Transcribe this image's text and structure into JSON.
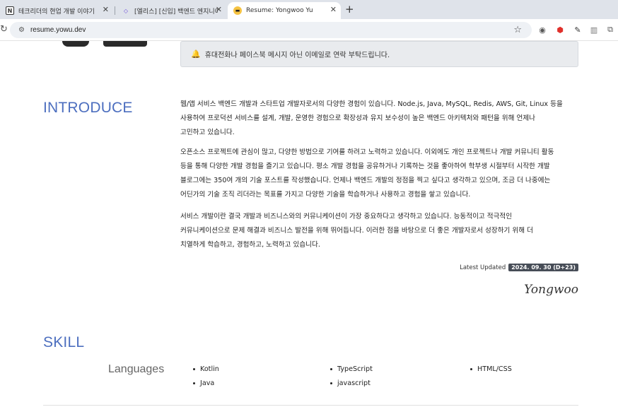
{
  "browser": {
    "tabs": [
      {
        "title": "테크리더의 현업 개발 이야기",
        "icon": "notion-icon"
      },
      {
        "title": "[엘리스] [신입] 백엔드 엔지니어 (",
        "icon": "elice-icon"
      },
      {
        "title": "Resume: Yongwoo Yu",
        "icon": "sunglasses-emoji-icon",
        "active": true
      }
    ],
    "url": "resume.yowu.dev"
  },
  "notice": {
    "text": "휴대전화나 페이스북 메시지 아닌 이메일로 연락 부탁드립니다."
  },
  "introduce": {
    "title": "INTRODUCE",
    "paragraphs": [
      [
        "웹/앱 서비스 백엔드 개발과 스타트업 개발자로서의 다양한 경험이 있습니다. Node.js, Java, MySQL, Redis, AWS, Git, Linux 등을",
        "사용하여 프로덕션 서비스를 설계, 개발, 운영한 경험으로 확장성과 유지 보수성이 높은 백엔드 아키텍처와 패턴을 위해 언제나",
        "고민하고 있습니다."
      ],
      [
        "오픈소스 프로젝트에 관심이 많고, 다양한 방법으로 기여를 하려고 노력하고 있습니다. 이외에도 개인 프로젝트나 개발 커뮤니티 활동",
        "등을 통해 다양한 개발 경험을 즐기고 있습니다. 평소 개발 경험을 공유하거나 기록하는 것을 좋아하여 학부생 시절부터 시작한 개발",
        "블로그에는 350여 개의 기술 포스트를 작성했습니다. 언제나 백엔드 개발의 정점을 찍고 싶다고 생각하고 있으며, 조금 더 나중에는",
        "어딘가의 기술 조직 리더라는 목표를 가지고 다양한 기술을 학습하거나 사용하고 경험을 쌓고 있습니다."
      ],
      [
        "서비스 개발이란 결국 개발과 비즈니스와의 커뮤니케이션이 가장 중요하다고 생각하고 있습니다. 능동적이고 적극적인",
        "커뮤니케이션으로 문제 해결과 비즈니스 발전을 위해 뛰어듭니다. 이러한 점을 바탕으로 더 좋은 개발자로서 성장하기 위해 더",
        "치열하게 학습하고, 경험하고, 노력하고 있습니다."
      ]
    ],
    "updated_label": "Latest Updated",
    "updated_badge": "2024. 09. 30 (D+23)",
    "signature": "Yongwoo"
  },
  "skill": {
    "title": "SKILL",
    "languages_label": "Languages",
    "columns": [
      [
        "Kotlin",
        "Java"
      ],
      [
        "TypeScript",
        "javascript"
      ],
      [
        "HTML/CSS"
      ]
    ]
  },
  "colors": {
    "accent": "#4d6fbf",
    "badge": "#474d57"
  }
}
